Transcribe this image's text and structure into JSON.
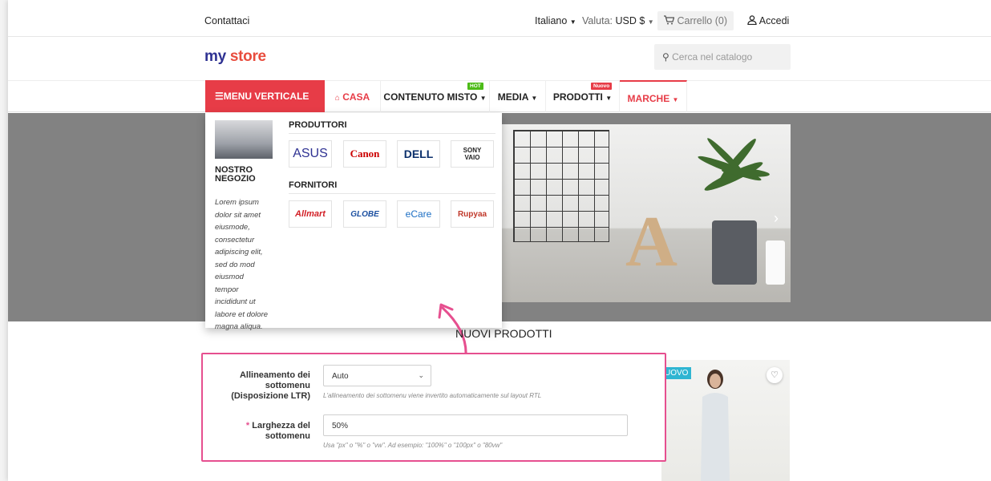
{
  "topbar": {
    "contact": "Contattaci",
    "language": "Italiano",
    "currency_label": "Valuta:",
    "currency_value": "USD $",
    "cart": "Carrello (0)",
    "login": "Accedi"
  },
  "header": {
    "logo_part1": "my",
    "logo_part2": "store",
    "search_placeholder": "Cerca nel catalogo"
  },
  "nav": {
    "vertical_menu": "☰MENU VERTICALE",
    "items": [
      {
        "label": "CASA",
        "badge": ""
      },
      {
        "label": "CONTENUTO MISTO",
        "badge": "HOT"
      },
      {
        "label": "MEDIA",
        "badge": ""
      },
      {
        "label": "PRODOTTI",
        "badge": "Nuovo"
      },
      {
        "label": "MARCHE",
        "badge": ""
      }
    ]
  },
  "dropdown": {
    "store_title": "NOSTRO NEGOZIO",
    "store_text": "Lorem ipsum dolor sit amet eiusmode, consectetur adipiscing elit, sed do mod eiusmod tempor incididunt ut labore et dolore magna aliqua.",
    "manufacturers_title": "PRODUTTORI",
    "manufacturers": [
      "ASUS",
      "Canon",
      "DELL",
      "SONY VAIO"
    ],
    "suppliers_title": "FORNITORI",
    "suppliers": [
      "Allmart",
      "GLOBE",
      "eCare",
      "Rupyaa"
    ]
  },
  "section": {
    "new_products": "NUOVI PRODOTTI",
    "product_badge": "UOVO"
  },
  "settings": {
    "alignment_label_line1": "Allineamento dei sottomenu",
    "alignment_label_line2": "(Disposizione LTR)",
    "alignment_value": "Auto",
    "alignment_help": "L'allineamento dei sottomenu viene invertito automaticamente sul layout RTL",
    "width_label": "Larghezza del sottomenu",
    "width_value": "50%",
    "width_help": "Usa \"px\" o \"%\" o \"vw\". Ad esempio: \"100%\" o \"100px\" o \"80vw\""
  },
  "colors": {
    "accent": "#e73c47",
    "highlight": "#e64f8f",
    "hot_badge": "#4cbb17",
    "new_badge": "#e73c47"
  }
}
